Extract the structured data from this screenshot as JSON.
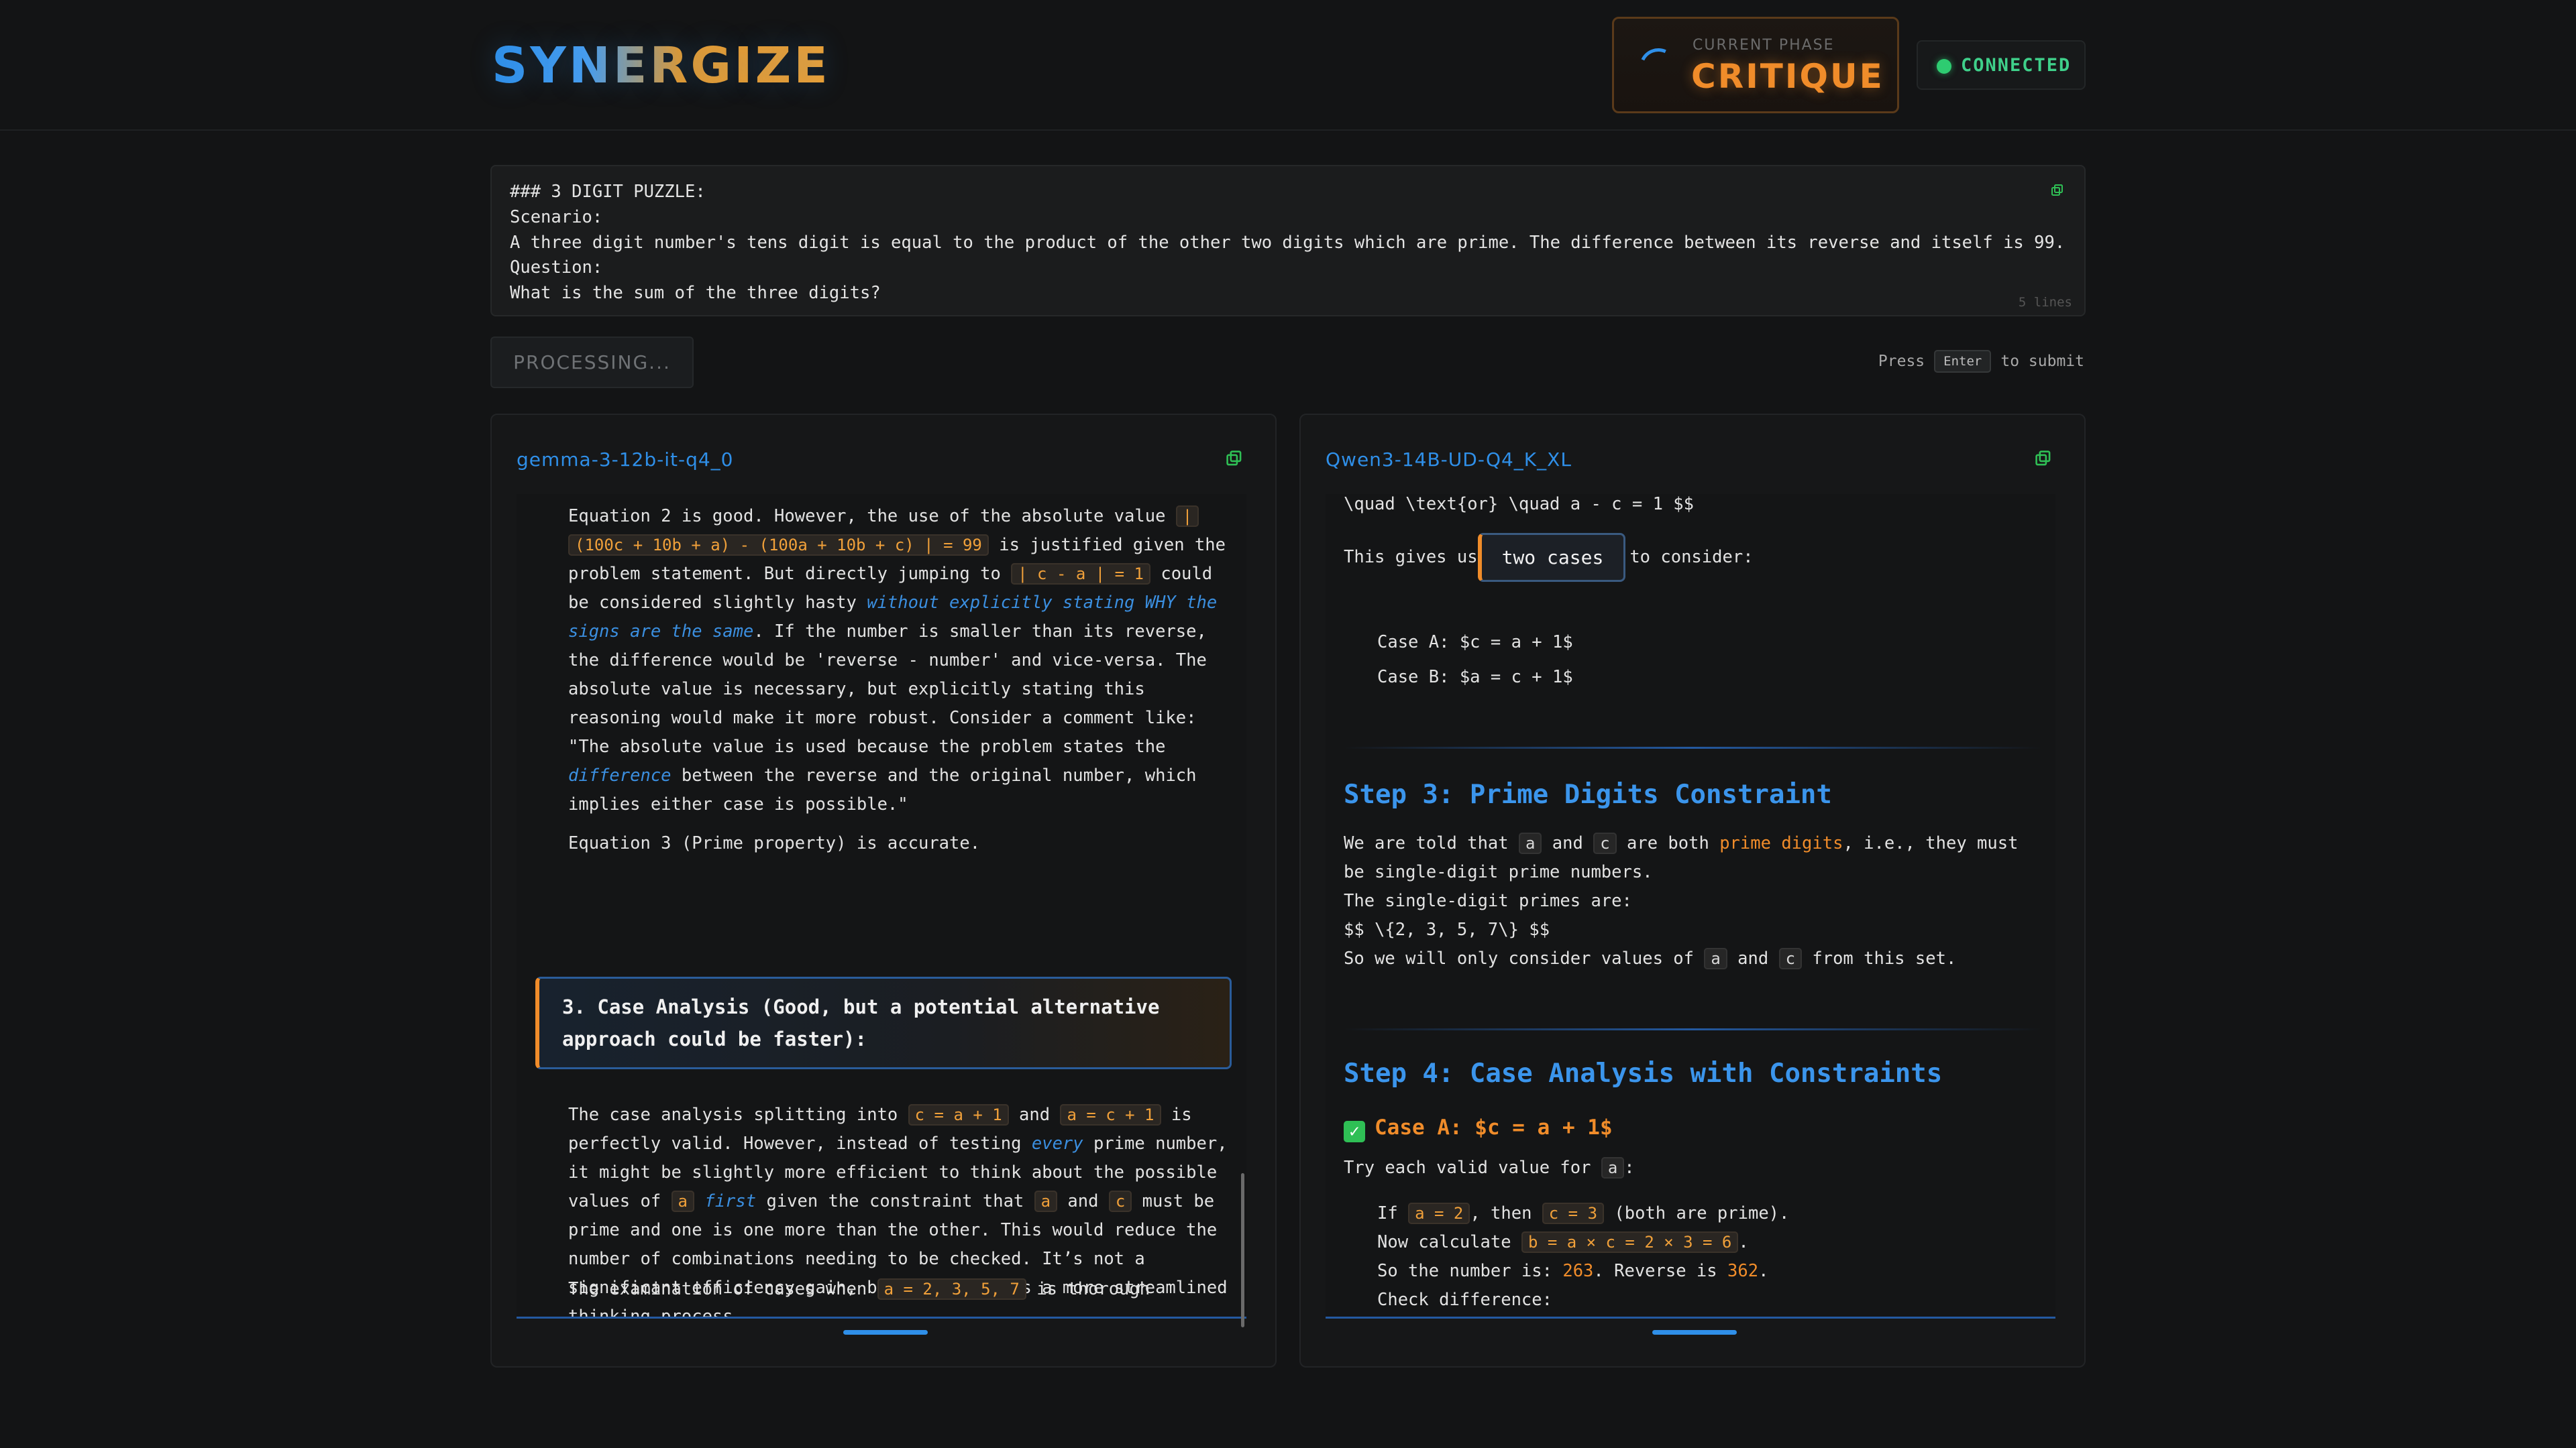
{
  "header": {
    "logo": "SYNERGIZE",
    "phase_label": "CURRENT PHASE",
    "phase_value": "CRITIQUE",
    "connection": "CONNECTED"
  },
  "prompt": {
    "text": "### 3 DIGIT PUZZLE:\nScenario:\nA three digit number's tens digit is equal to the product of the other two digits which are prime. The difference between its reverse and itself is 99.\nQuestion:\nWhat is the sum of the three digits?",
    "line_count": "5 lines"
  },
  "actions": {
    "processing": "PROCESSING...",
    "hint_pre": "Press",
    "hint_key": "Enter",
    "hint_post": "to submit"
  },
  "left_panel": {
    "model": "gemma-3-12b-it-q4_0",
    "para1": {
      "t1": "Equation 2 is good. However, the use of the absolute value ",
      "c1": "|",
      "c2": "(100c + 10b + a) - (100a + 10b + c) | = 99",
      "t2": " is justified given the",
      "t3": "problem statement. But directly jumping to ",
      "c3": "| c - a | = 1",
      "t4": " could",
      "t5": "be considered slightly hasty ",
      "em1": "without explicitly stating WHY the",
      "em2": "signs are the same",
      "t6": ". If the number is smaller than its reverse,",
      "t7": "the difference would be 'reverse - number' and vice-versa. The",
      "t8": "absolute value is necessary, but explicitly stating this",
      "t9": "reasoning would make it more robust. Consider a comment like:",
      "t10": "\"The absolute value is used because the problem states the",
      "em3": "difference",
      "t11": " between the reverse and the original number, which",
      "t12": "implies either case is possible.\""
    },
    "para2": "Equation 3 (Prime property) is accurate.",
    "section_title_1": "3. Case Analysis (Good, but a potential alternative",
    "section_title_2": "approach could be faster):",
    "para3": {
      "t1": "The case analysis splitting into ",
      "c1": "c = a + 1",
      "t2": " and ",
      "c2": "a = c + 1",
      "t3": " is",
      "t4": "perfectly valid. However, instead of testing ",
      "em1": "every",
      "t5": " prime number,",
      "t6": "it might be slightly more efficient to think about the possible",
      "t7": "values of ",
      "c3": "a",
      "em2": "first",
      "t8": " given the constraint that ",
      "c4": "a",
      "t9": " and ",
      "c5": "c",
      "t10": " must be",
      "t11": "prime and one is one more than the other. This would reduce the",
      "t12": "number of combinations needing to be checked. It’s not a",
      "t13": "significant efficiency gain, but it showcases a more streamlined",
      "t14": "thinking process."
    },
    "para4": {
      "t1": "The examination of cases when ",
      "c1": "a = 2, 3, 5, 7",
      "t2": " is thorough"
    }
  },
  "right_panel": {
    "model": "Qwen3-14B-UD-Q4_K_XL",
    "line1": "\\quad \\text{or} \\quad a - c = 1 $$",
    "gives_pre": "This gives us ",
    "gives_box": "two cases",
    "gives_post": " to consider:",
    "case_a": "Case A: $c = a + 1$",
    "case_b": "Case B: $a = c + 1$",
    "step3": {
      "title": "Step 3: Prime Digits Constraint",
      "t1": "We are told that ",
      "c1": "a",
      "t2": " and ",
      "c2": "c",
      "t3": " are both ",
      "hl": "prime digits",
      "t4": ", i.e., they must",
      "t5": "be single-digit prime numbers.",
      "t6": "The single-digit primes are:",
      "t7": "$$ \\{2, 3, 5, 7\\} $$",
      "t8": "So we will only consider values of ",
      "c3": "a",
      "t9": " and ",
      "c4": "c",
      "t10": " from this set."
    },
    "step4": {
      "title": "Step 4: Case Analysis with Constraints",
      "case_head": "Case A: $c = a + 1$",
      "try_pre": "Try each valid value for ",
      "try_code": "a",
      "try_post": ":",
      "if_pre": "If ",
      "if_c1": "a = 2",
      "if_mid": ", then ",
      "if_c2": "c = 3",
      "if_post": " (both are prime).",
      "now_pre": "Now calculate ",
      "now_code": "b = a × c = 2 × 3 = 6",
      "now_post": ".",
      "num_pre": "So the number is: ",
      "num_val": "263",
      "num_mid": ". Reverse is ",
      "rev_val": "362",
      "num_post": ".",
      "check": "Check difference:"
    }
  },
  "colors": {
    "accent_blue": "#2f8fe8",
    "accent_orange": "#f08c2a",
    "status_green": "#2ecc71",
    "background": "#131415"
  },
  "icons": {
    "copy": "copy-icon",
    "spinner": "spinner-icon",
    "status": "status-dot-icon",
    "check": "check-icon"
  }
}
